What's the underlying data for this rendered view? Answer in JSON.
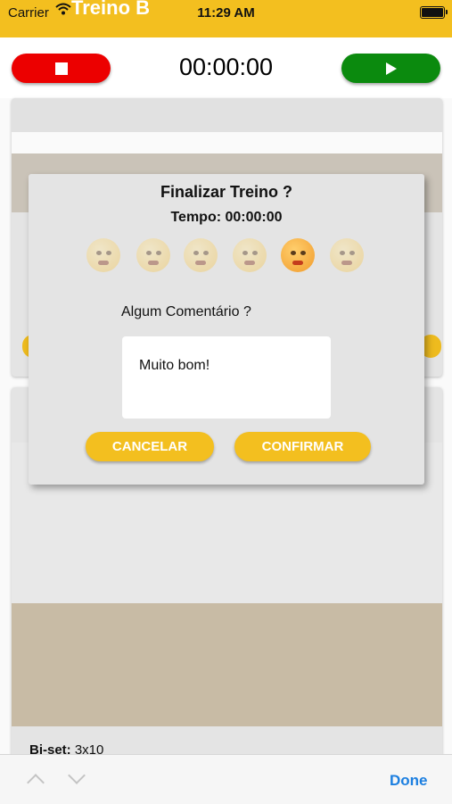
{
  "status_bar": {
    "carrier": "Carrier",
    "time": "11:29 AM"
  },
  "nav": {
    "title": "Treino B"
  },
  "timer": {
    "display": "00:00:00"
  },
  "dialog": {
    "title": "Finalizar Treino ?",
    "time_text": "Tempo: 00:00:00",
    "emojis": [
      "very-sad-emoji-icon",
      "thinking-emoji-icon",
      "worried-emoji-icon",
      "surprised-emoji-icon",
      "pointing-emoji-icon",
      "sick-emoji-icon"
    ],
    "selected_emoji_index": 4,
    "comment_label": "Algum Comentário ?",
    "comment_value": "Muito bom!",
    "cancel_label": "CANCELAR",
    "confirm_label": "CONFIRMAR"
  },
  "cards": [
    {
      "photo": "exercise-photo"
    },
    {
      "photo": "exercise-photo",
      "label_bold": "Bi-set:",
      "label_value": " 3x10"
    }
  ],
  "keyboard_toolbar": {
    "done_label": "Done"
  },
  "colors": {
    "accent": "#f3bf1f",
    "stop": "#ec0000",
    "play": "#0b8a0e",
    "link": "#1c7fe0"
  }
}
